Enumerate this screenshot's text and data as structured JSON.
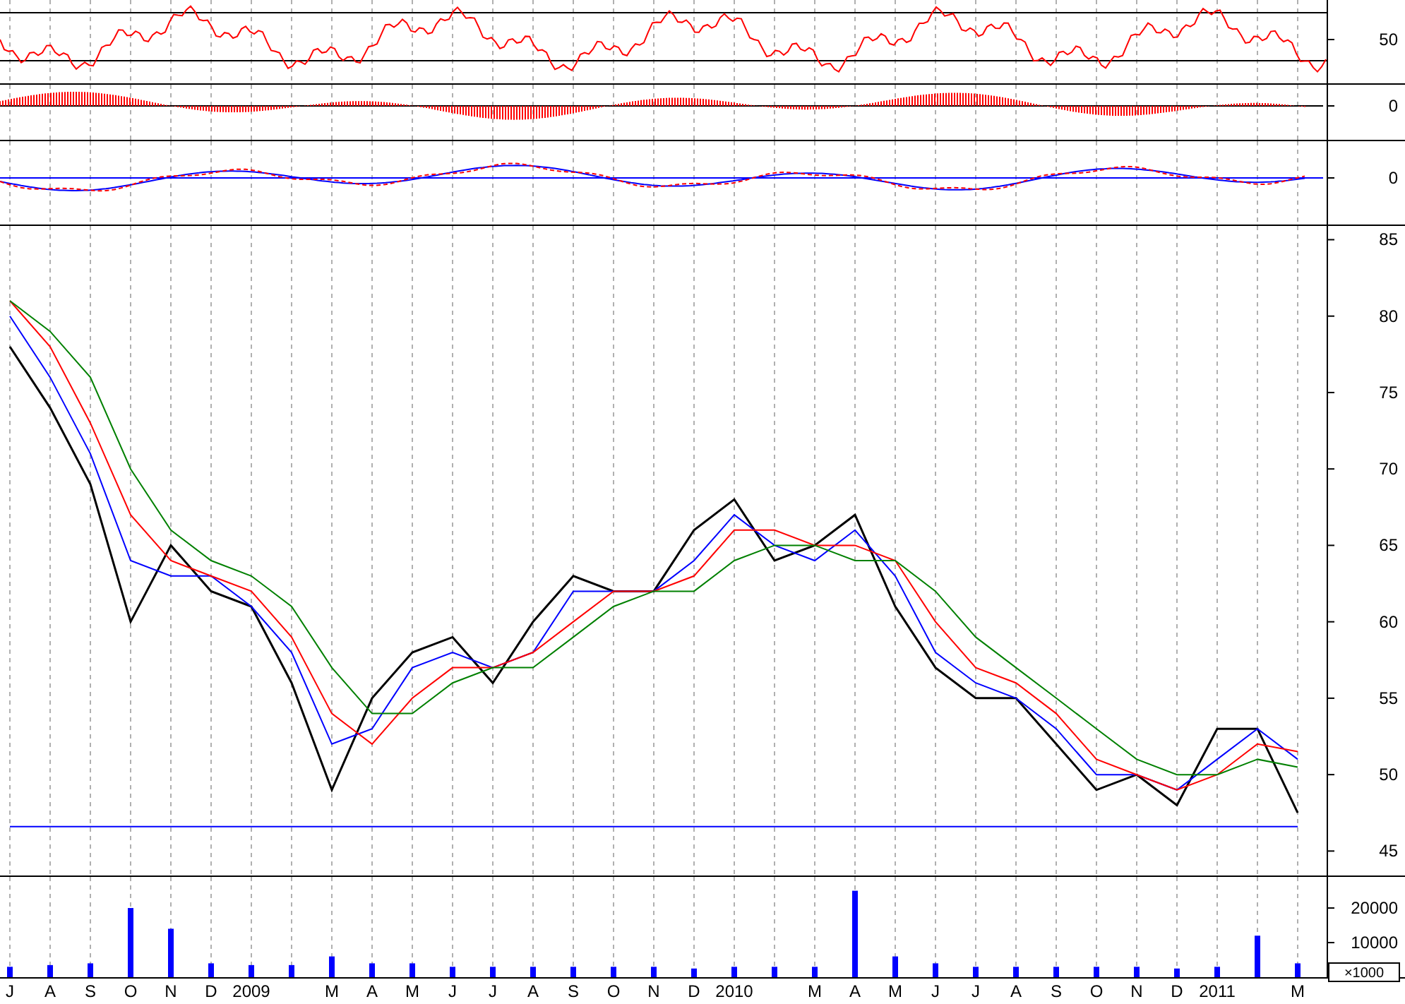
{
  "oscillator_panels": [
    {
      "kind": "line",
      "tick_labels": [
        "50"
      ]
    },
    {
      "kind": "histogram",
      "tick_labels": [
        "0"
      ]
    },
    {
      "kind": "dual",
      "tick_labels": [
        "0"
      ]
    }
  ],
  "price_chart": {
    "chart_data": {
      "type": "line",
      "ylim": [
        43.4,
        85.9
      ],
      "yticks": [
        45,
        50,
        55,
        60,
        65,
        70,
        75,
        80,
        85
      ],
      "grid": true,
      "series": [
        {
          "color": "#000000",
          "values": [
            78,
            74,
            69,
            60,
            65,
            62,
            61,
            56,
            49,
            55,
            58,
            59,
            56,
            60,
            63,
            62,
            62,
            66,
            68,
            64,
            65,
            67,
            61,
            57,
            55,
            55,
            52,
            49,
            50,
            48,
            53,
            53,
            47.5
          ]
        },
        {
          "color": "#0000ff",
          "values": [
            80,
            76,
            71,
            64,
            63,
            63,
            61,
            58,
            52,
            53,
            57,
            58,
            57,
            58,
            62,
            62,
            62,
            64,
            67,
            65,
            64,
            66,
            63,
            58,
            56,
            55,
            53,
            50,
            50,
            49,
            51,
            53,
            51
          ]
        },
        {
          "color": "#ff0000",
          "values": [
            81,
            78,
            73,
            67,
            64,
            63,
            62,
            59,
            54,
            52,
            55,
            57,
            57,
            58,
            60,
            62,
            62,
            63,
            66,
            66,
            65,
            65,
            64,
            60,
            57,
            56,
            54,
            51,
            50,
            49,
            50,
            52,
            51.5
          ]
        },
        {
          "color": "#008000",
          "values": [
            81,
            79,
            76,
            70,
            66,
            64,
            63,
            61,
            57,
            54,
            54,
            56,
            57,
            57,
            59,
            61,
            62,
            62,
            64,
            65,
            65,
            64,
            64,
            62,
            59,
            57,
            55,
            53,
            51,
            50,
            50,
            51,
            50.5
          ]
        },
        {
          "color": "#0000ff",
          "values": [
            46.6,
            46.6,
            46.6,
            46.6,
            46.6,
            46.6,
            46.6,
            46.6,
            46.6,
            46.6,
            46.6,
            46.6,
            46.6,
            46.6,
            46.6,
            46.6,
            46.6,
            46.6,
            46.6,
            46.6,
            46.6,
            46.6,
            46.6,
            46.6,
            46.6,
            46.6,
            46.6,
            46.6,
            46.6,
            46.6,
            46.6,
            46.6,
            46.6
          ]
        }
      ]
    }
  },
  "volume_chart": {
    "unit_label": "×1000",
    "chart_data": {
      "type": "bar",
      "ylim": [
        0,
        29000
      ],
      "yticks": [
        10000,
        20000
      ],
      "grid": true,
      "categories": [
        "J",
        "A",
        "S",
        "O",
        "N",
        "D",
        "2009",
        null,
        "M",
        "A",
        "M",
        "J",
        "J",
        "A",
        "S",
        "O",
        "N",
        "D",
        "2010",
        null,
        "M",
        "A",
        "M",
        "J",
        "J",
        "A",
        "S",
        "O",
        "N",
        "D",
        "2011",
        null,
        "M"
      ],
      "series": [
        {
          "color": "#0000ff",
          "values": [
            3000,
            3500,
            4000,
            20000,
            14000,
            4000,
            3500,
            3500,
            6000,
            4000,
            4000,
            3000,
            3000,
            3000,
            3000,
            3000,
            3000,
            2500,
            3000,
            3000,
            3000,
            25000,
            6000,
            4000,
            3000,
            3000,
            3000,
            3000,
            3000,
            2500,
            3000,
            12000,
            4000
          ]
        }
      ]
    }
  }
}
